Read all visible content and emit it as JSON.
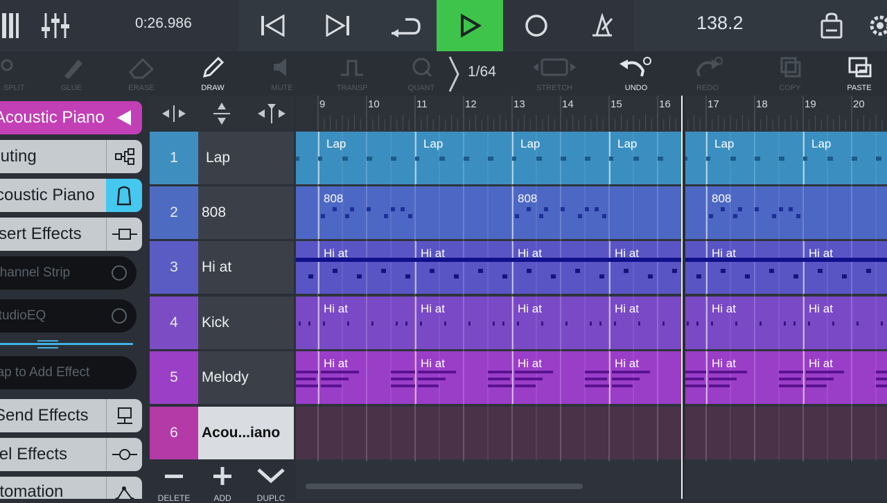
{
  "transport": {
    "time": "0:26.986",
    "tempo": "138.2",
    "buttons": [
      "rewind",
      "forward",
      "loop",
      "play",
      "record",
      "metronome"
    ],
    "play_color": "#3ec44a"
  },
  "tools": {
    "split": "SPLIT",
    "glue": "GLUE",
    "erase": "ERASE",
    "draw": "DRAW",
    "mute": "MUTE",
    "transp": "TRANSP",
    "quant": "QUANT",
    "grid": "1/64",
    "stretch": "STRETCH",
    "undo": "UNDO",
    "redo": "REDO",
    "copy": "COPY",
    "paste": "PASTE"
  },
  "left_panel": {
    "instrument_title": "Acoustic Piano",
    "routing": "Routing",
    "instrument": "Acoustic Piano",
    "insert_effects": "Insert Effects",
    "fx1": "Channel Strip",
    "fx2": "StudioEQ",
    "add_effect": "Tap to Add Effect",
    "send_effects": "Send Effects",
    "channel_effects": "Channel Effects",
    "automation": "Automation",
    "accent": "#c33fb6",
    "icon_accent": "#45c8ef"
  },
  "tracks": [
    {
      "num": "1",
      "name": "Lap",
      "color": "#3e8fc0",
      "lane": "#3b8fc0"
    },
    {
      "num": "2",
      "name": "808",
      "color": "#4e6bc2",
      "lane": "#4d67c4"
    },
    {
      "num": "3",
      "name": "Hi at",
      "color": "#5a5cc4",
      "lane": "#5a55c5"
    },
    {
      "num": "4",
      "name": "Kick",
      "color": "#7b4cc4",
      "lane": "#7a4ac6"
    },
    {
      "num": "5",
      "name": "Melody",
      "color": "#9a3fc6",
      "lane": "#9a3ec8"
    },
    {
      "num": "6",
      "name": "Acou...iano",
      "color": "#b43aa8",
      "lane": "#4a3348"
    }
  ],
  "ruler_numbers": [
    "9",
    "10",
    "11",
    "12",
    "13",
    "14",
    "15",
    "16",
    "17",
    "18",
    "19",
    "20"
  ],
  "clip_labels": {
    "lane1": "Lap",
    "lane2": "808",
    "lane3": "Hi at",
    "lane4": "Hi at",
    "lane5": "Hi at"
  },
  "track_toolbar": {
    "delete": "DELETE",
    "add": "ADD",
    "duplicate": "DUPLC"
  }
}
